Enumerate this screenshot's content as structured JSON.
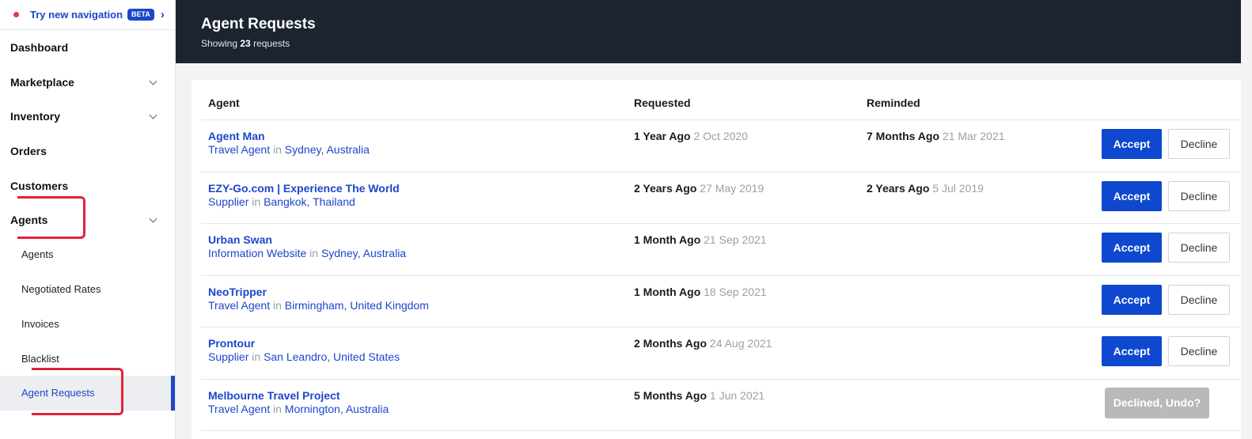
{
  "sidebar": {
    "try_nav": {
      "label": "Try new navigation",
      "badge": "BETA"
    },
    "items": [
      {
        "label": "Dashboard"
      },
      {
        "label": "Marketplace"
      },
      {
        "label": "Inventory"
      },
      {
        "label": "Orders"
      },
      {
        "label": "Customers"
      },
      {
        "label": "Agents"
      }
    ],
    "sub_items": [
      {
        "label": "Agents"
      },
      {
        "label": "Negotiated Rates"
      },
      {
        "label": "Invoices"
      },
      {
        "label": "Blacklist"
      },
      {
        "label": "Agent Requests"
      }
    ]
  },
  "header": {
    "title": "Agent Requests",
    "showing_prefix": "Showing",
    "count": "23",
    "showing_suffix": "requests"
  },
  "table": {
    "columns": [
      "Agent",
      "Requested",
      "Reminded"
    ],
    "in_word": "in",
    "accept_label": "Accept",
    "decline_label": "Decline",
    "undo_label": "Declined, Undo?",
    "rows": [
      {
        "name": "Agent Man",
        "type": "Travel Agent",
        "city": "Sydney",
        "country": "Australia",
        "requested_ago": "1 Year Ago",
        "requested_date": "2 Oct 2020",
        "reminded_ago": "7 Months Ago",
        "reminded_date": "21 Mar 2021"
      },
      {
        "name": "EZY-Go.com | Experience The World",
        "type": "Supplier",
        "city": "Bangkok",
        "country": "Thailand",
        "requested_ago": "2 Years Ago",
        "requested_date": "27 May 2019",
        "reminded_ago": "2 Years Ago",
        "reminded_date": "5 Jul 2019"
      },
      {
        "name": "Urban Swan",
        "type": "Information Website",
        "city": "Sydney",
        "country": "Australia",
        "requested_ago": "1 Month Ago",
        "requested_date": "21 Sep 2021",
        "reminded_ago": "",
        "reminded_date": ""
      },
      {
        "name": "NeoTripper",
        "type": "Travel Agent",
        "city": "Birmingham",
        "country": "United Kingdom",
        "requested_ago": "1 Month Ago",
        "requested_date": "18 Sep 2021",
        "reminded_ago": "",
        "reminded_date": ""
      },
      {
        "name": "Prontour",
        "type": "Supplier",
        "city": "San Leandro",
        "country": "United States",
        "requested_ago": "2 Months Ago",
        "requested_date": "24 Aug 2021",
        "reminded_ago": "",
        "reminded_date": ""
      },
      {
        "name": "Melbourne Travel Project",
        "type": "Travel Agent",
        "city": "Mornington",
        "country": "Australia",
        "requested_ago": "5 Months Ago",
        "requested_date": "1 Jun 2021",
        "reminded_ago": "",
        "reminded_date": ""
      }
    ]
  },
  "colors": {
    "accent": "#0d48cf",
    "header_bg": "#1c2430",
    "annotation": "#e3213a"
  }
}
